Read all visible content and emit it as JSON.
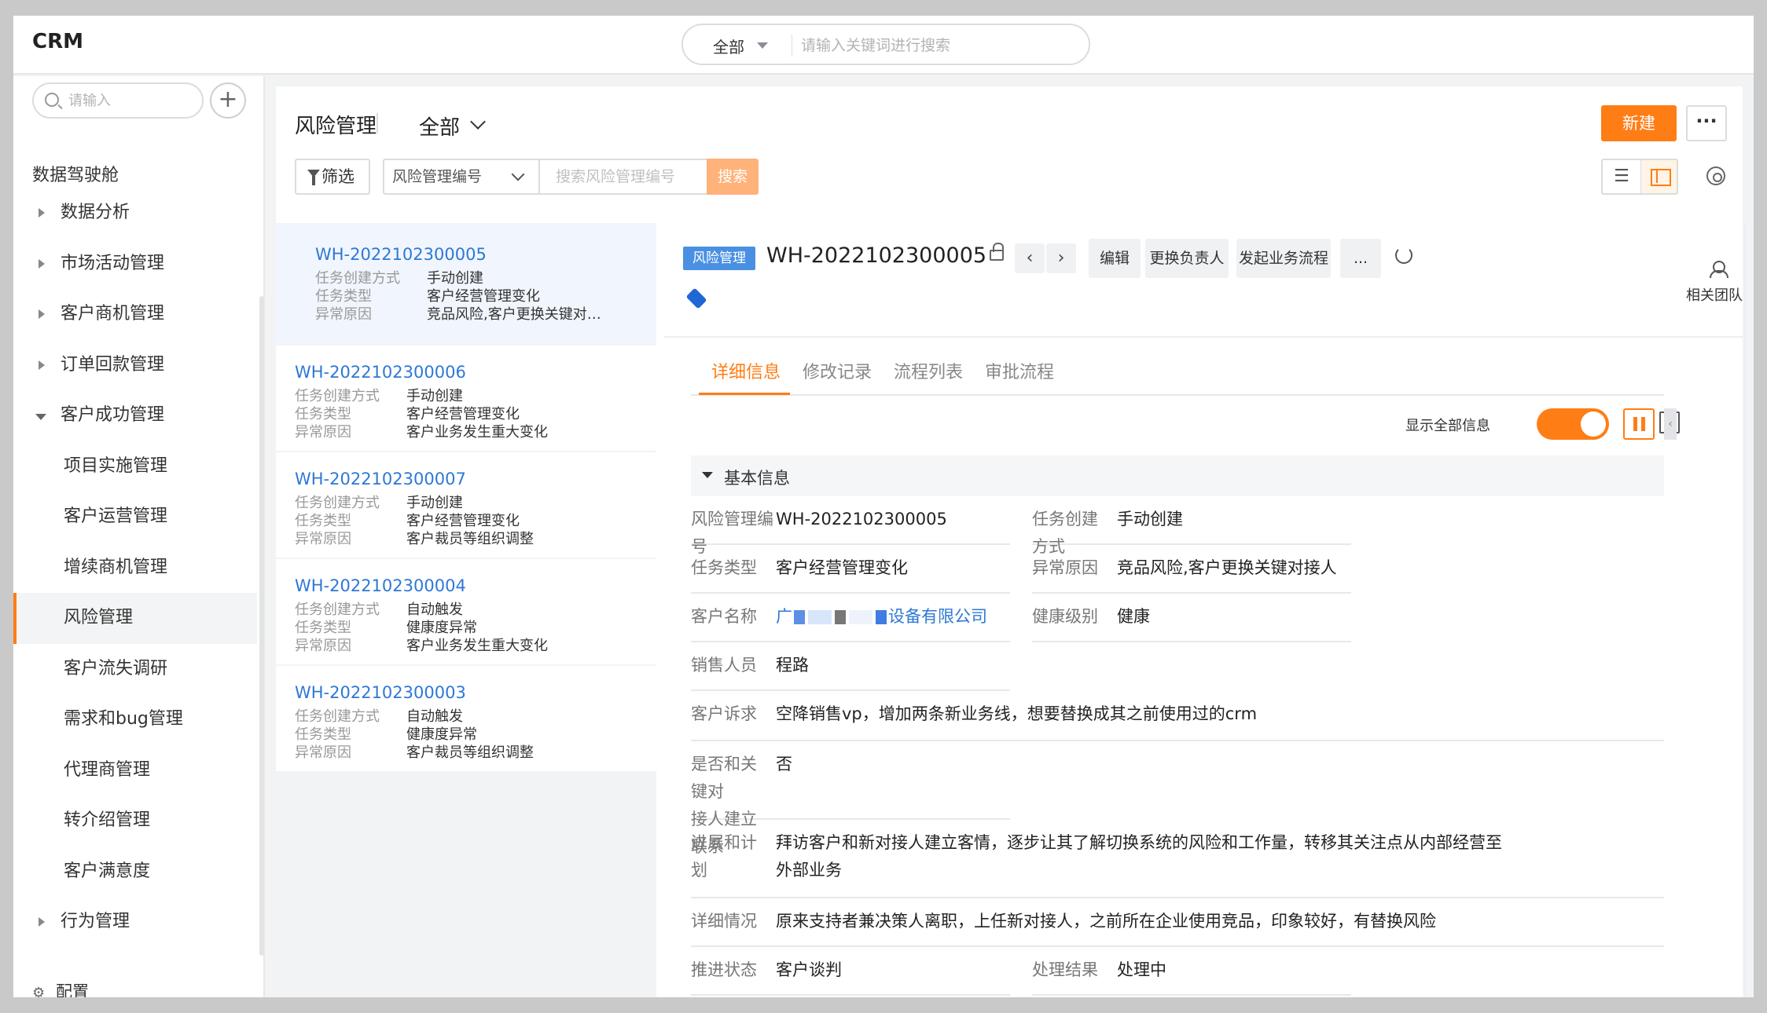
{
  "app": {
    "brand": "CRM"
  },
  "global_search": {
    "scope": "全部",
    "placeholder": "请输入关键词进行搜索"
  },
  "sidebar": {
    "search_placeholder": "请输入",
    "add_icon": "plus-icon",
    "home": "数据驾驶舱",
    "items": [
      {
        "label": "数据分析",
        "type": "group"
      },
      {
        "label": "市场活动管理",
        "type": "group"
      },
      {
        "label": "客户商机管理",
        "type": "group"
      },
      {
        "label": "订单回款管理",
        "type": "group"
      },
      {
        "label": "客户成功管理",
        "type": "group-open"
      },
      {
        "label": "项目实施管理",
        "type": "sub"
      },
      {
        "label": "客户运营管理",
        "type": "sub"
      },
      {
        "label": "增续商机管理",
        "type": "sub"
      },
      {
        "label": "风险管理",
        "type": "sub-active"
      },
      {
        "label": "客户流失调研",
        "type": "sub"
      },
      {
        "label": "需求和bug管理",
        "type": "sub"
      },
      {
        "label": "代理商管理",
        "type": "sub"
      },
      {
        "label": "转介绍管理",
        "type": "sub"
      },
      {
        "label": "客户满意度",
        "type": "sub"
      },
      {
        "label": "行为管理",
        "type": "group"
      }
    ],
    "config": "配置"
  },
  "header": {
    "title": "风险管理",
    "view": "全部",
    "new_button": "新建",
    "more_button": "···"
  },
  "filter": {
    "filter_button": "筛选",
    "field_select": "风险管理编号",
    "search_placeholder": "搜索风险管理编号",
    "search_button": "搜索"
  },
  "list": [
    {
      "id": "WH-2022102300005",
      "method": "手动创建",
      "type": "客户经营管理变化",
      "reason": "竞品风险,客户更换关键对…",
      "selected": true
    },
    {
      "id": "WH-2022102300006",
      "method": "手动创建",
      "type": "客户经营管理变化",
      "reason": "客户业务发生重大变化"
    },
    {
      "id": "WH-2022102300007",
      "method": "手动创建",
      "type": "客户经营管理变化",
      "reason": "客户裁员等组织调整"
    },
    {
      "id": "WH-2022102300004",
      "method": "自动触发",
      "type": "健康度异常",
      "reason": "客户业务发生重大变化"
    },
    {
      "id": "WH-2022102300003",
      "method": "自动触发",
      "type": "健康度异常",
      "reason": "客户裁员等组织调整"
    }
  ],
  "list_labels": {
    "method": "任务创建方式",
    "type": "任务类型",
    "reason": "异常原因"
  },
  "detail": {
    "tag": "风险管理",
    "id": "WH-2022102300005",
    "actions": [
      "编辑",
      "更换负责人",
      "发起业务流程",
      "..."
    ],
    "tabs": [
      "详细信息",
      "修改记录",
      "流程列表",
      "审批流程"
    ],
    "show_all_label": "显示全部信息",
    "show_all_on": true,
    "section_title": "基本信息",
    "related_team": "相关团队",
    "fields": {
      "code": {
        "label": "风险管理编号",
        "value": "WH-2022102300005"
      },
      "method": {
        "label": "任务创建方式",
        "value": "手动创建"
      },
      "type": {
        "label": "任务类型",
        "value": "客户经营管理变化"
      },
      "reason": {
        "label": "异常原因",
        "value": "竞品风险,客户更换关键对接人"
      },
      "customer": {
        "label": "客户名称",
        "prefix": "广",
        "suffix": "设备有限公司"
      },
      "health": {
        "label": "健康级别",
        "value": "健康"
      },
      "sales": {
        "label": "销售人员",
        "value": "程路"
      },
      "appeal": {
        "label": "客户诉求",
        "value": "空降销售vp，增加两条新业务线，想要替换成其之前使用过的crm"
      },
      "contact_l1": "是否和关键对",
      "contact_l2": "接人建立联系",
      "contact_value": "否",
      "progress": {
        "label": "进展和计划",
        "line1": "拜访客户和新对接人建立客情，逐步让其了解切换系统的风险和工作量，转移其关注点从内部经营至",
        "line2": "外部业务"
      },
      "situation": {
        "label": "详细情况",
        "value": "原来支持者兼决策人离职，上任新对接人，之前所在企业使用竞品，印象较好，有替换风险"
      },
      "status": {
        "label": "推进状态",
        "value": "客户谈判"
      },
      "result": {
        "label": "处理结果",
        "value": "处理中"
      }
    }
  },
  "colors": {
    "accent": "#ff7d15",
    "link": "#2d78d6",
    "tag": "#4a90e2"
  }
}
